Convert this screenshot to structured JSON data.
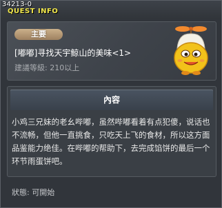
{
  "window": {
    "quest_id": "34213-0",
    "title": "QUEST INFO"
  },
  "header": {
    "badge_label": "主要",
    "quest_name": "[嘟嘟]寻找天宇鲸山的美味<1>",
    "level_requirement": "建議等級: 210以上",
    "npc_icon": "npc-chicken-helmet-icon"
  },
  "content": {
    "header_label": "內容",
    "description": "小鸡三兄妹的老幺哔嘟，虽然哔嘟看着有点犯傻，说话也不流畅，但他一直挑食，只吃天上飞的食材，所以这方面品鉴能力绝佳。在哔嘟的帮助下，去完成馅饼的最后一个环节雨蛋饼吧。"
  },
  "footer": {
    "status": "狀態: 可開始"
  },
  "colors": {
    "title": "#f0e64a",
    "badge": "#b39670",
    "panel": "#3a3f45",
    "npc": "#f2c21a"
  }
}
